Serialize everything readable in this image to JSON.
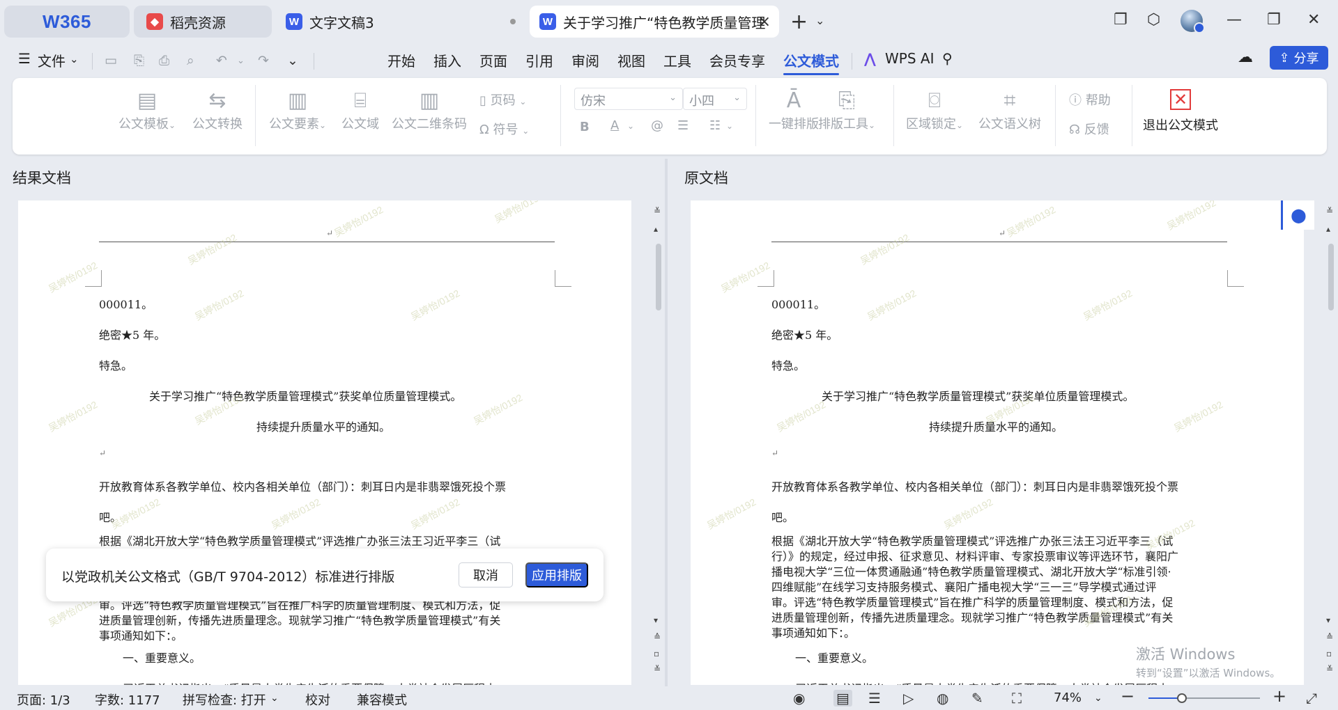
{
  "titlebar": {
    "home_logo": "W365",
    "tabs": [
      {
        "label": "稻壳资源"
      },
      {
        "label": "文字文稿3"
      },
      {
        "label": "关于学习推广“特色教学质量管理"
      }
    ],
    "new_tab": "+",
    "tab_close": "×"
  },
  "menubar": {
    "file": "文件",
    "tabs": [
      "开始",
      "插入",
      "页面",
      "引用",
      "审阅",
      "视图",
      "工具",
      "会员专享",
      "公文模式"
    ],
    "active_tab": "公文模式",
    "wps_ai": "WPS AI",
    "share": "分享"
  },
  "ribbon": {
    "template": "公文模板",
    "convert": "公文转换",
    "elements": "公文要素",
    "domain": "公文域",
    "qrcode": "公文二维条码",
    "page_num": "页码",
    "symbol": "符号",
    "font": "仿宋",
    "size": "小四",
    "one_click": "一键排版",
    "layout_tools": "排版工具",
    "area_lock": "区域锁定",
    "semantic_tree": "公文语义树",
    "help": "帮助",
    "feedback": "反馈",
    "exit": "退出公文模式"
  },
  "panels": {
    "left_title": "结果文档",
    "right_title": "原文档"
  },
  "document": {
    "lines": [
      "000011。",
      "绝密★5 年。",
      "特急。",
      "关于学习推广“特色教学质量管理模式”获奖单位质量管理模式。",
      "持续提升质量水平的通知。",
      "↵",
      "开放教育体系各教学单位、校内各相关单位（部门）：刺耳日内是非翡翠饿死投个票",
      "吧。",
      "根据《湖北开放大学“特色教学质量管理模式”评选推广办张三法王习近平李三（试",
      "审。评选“特色教学质量管理模式”旨在推广科学的质量管理制度、模式和方法，促",
      "进质量管理创新，传播先进质量理念。现就学习推广“特色教学质量管理模式”有关",
      "事项通知如下：。",
      "一、重要意义。",
      "习近平总书记指出：“质量是人类生产生活的重要保障。人类社会发展历程中"
    ],
    "right_lines": [
      "根据《湖北开放大学“特色教学质量管理模式”评选推广办张三法王习近平李三（试",
      "行）》的规定，经过申报、征求意见、材料评审、专家投票审议等评选环节，襄阳广",
      "播电视大学“三位一体贯通融通”特色教学质量管理模式、湖北开放大学“标准引领·",
      "四维赋能”在线学习支持服务模式、襄阳广播电视大学“三一三”导学模式通过评",
      "审。评选“特色教学质量管理模式”旨在推广科学的质量管理制度、模式和方法，促",
      "进质量管理创新，传播先进质量理念。现就学习推广“特色教学质量管理模式”有关",
      "事项通知如下：。"
    ],
    "watermark": "吴婷怡/0192",
    "return_mark": "↵"
  },
  "dialog": {
    "message": "以党政机关公文格式（GB/T 9704-2012）标准进行排版",
    "cancel": "取消",
    "apply": "应用排版"
  },
  "activation": {
    "line1": "激活 Windows",
    "line2": "转到“设置”以激活 Windows。"
  },
  "statusbar": {
    "page": "页面: 1/3",
    "words": "字数: 1177",
    "spell": "拼写检查: 打开",
    "proof": "校对",
    "compat": "兼容模式",
    "zoom": "74%",
    "zoom_level": 0.3
  },
  "colors": {
    "accent": "#2d5bd9",
    "danger": "#e23b3b"
  }
}
